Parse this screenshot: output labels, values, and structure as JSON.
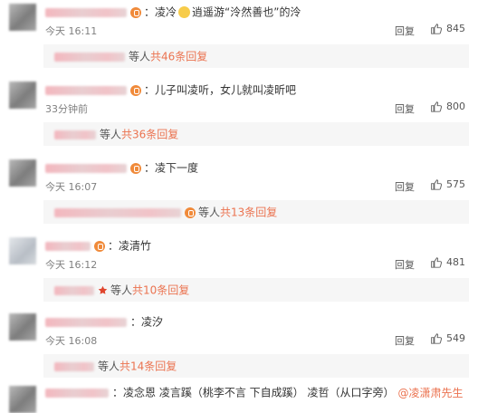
{
  "comments": [
    {
      "text_prefix": "：凌冷",
      "text_suffix": "逍遥游“泠然善也”的泠",
      "time": "今天 16:11",
      "reply_label": "回复",
      "likes": "845",
      "sub_label": "等人",
      "sub_link": "共46条回复"
    },
    {
      "text": "：儿子叫凌听，女儿就叫凌昕吧",
      "time": "33分钟前",
      "reply_label": "回复",
      "likes": "800",
      "sub_label": "等人",
      "sub_link": "共36条回复"
    },
    {
      "text": "：凌下一度",
      "time": "今天 16:07",
      "reply_label": "回复",
      "likes": "575",
      "sub_label": "等人",
      "sub_link": "共13条回复"
    },
    {
      "text": "：凌清竹",
      "time": "今天 16:12",
      "reply_label": "回复",
      "likes": "481",
      "sub_label": "等人",
      "sub_link": "共10条回复"
    },
    {
      "text": "：凌汐",
      "time": "今天 16:08",
      "reply_label": "回复",
      "likes": "549",
      "sub_label": "等人",
      "sub_link": "共14条回复"
    },
    {
      "text": "：凌念恩   凌言蹊（桃李不言 下自成蹊） 凌哲（从口字旁）",
      "mention": "@凌潇肃先生"
    }
  ],
  "colors": {
    "link": "#eb7350",
    "meta": "#808080",
    "subbar": "#f6f6f6"
  },
  "icons": {
    "like": "thumb-up-icon",
    "badge": "member-badge-icon"
  }
}
